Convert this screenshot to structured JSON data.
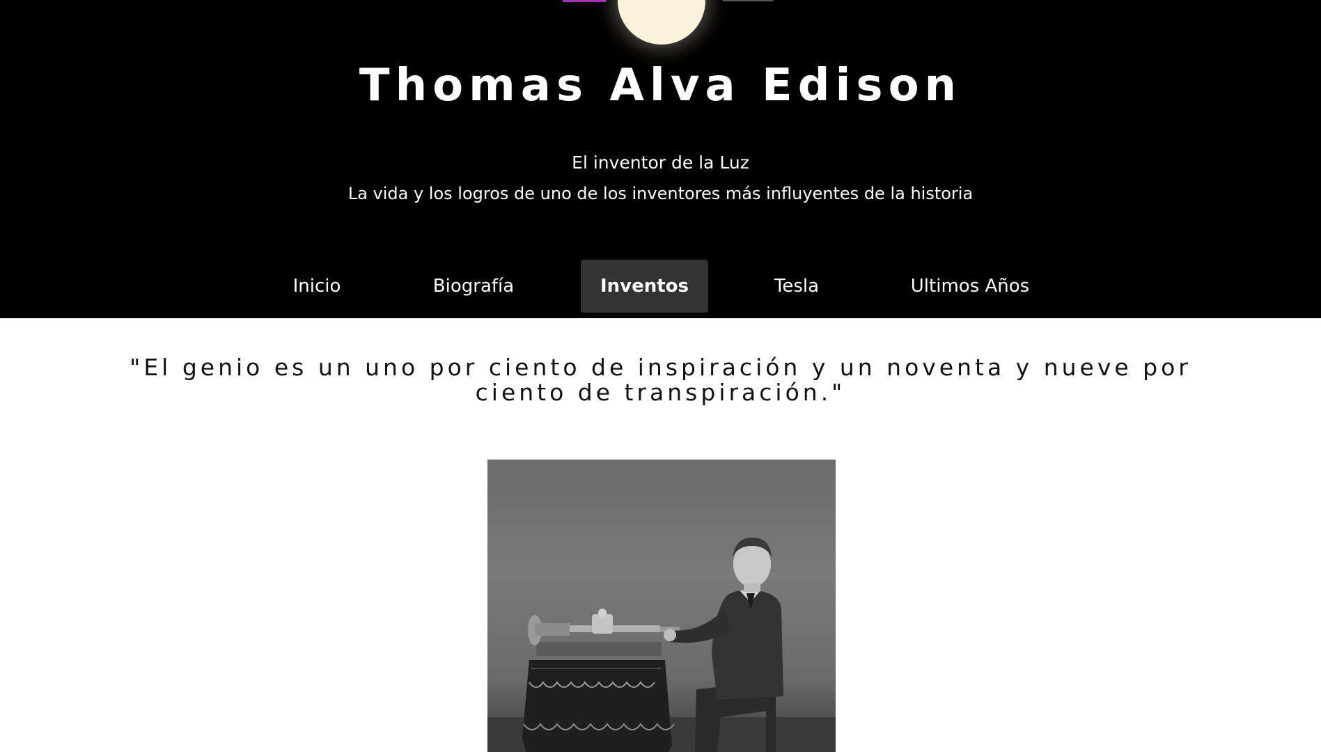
{
  "header": {
    "title": "Thomas Alva Edison",
    "tagline": "El inventor de la Luz",
    "subtitle": "La vida y los logros de uno de los inventores más influyentes de la historia"
  },
  "nav": {
    "items": [
      {
        "label": "Inicio",
        "active": false
      },
      {
        "label": "Biografía",
        "active": false
      },
      {
        "label": "Inventos",
        "active": true
      },
      {
        "label": "Tesla",
        "active": false
      },
      {
        "label": "Ultimos Años",
        "active": false
      }
    ]
  },
  "main": {
    "quote": "\"El genio es un uno por ciento de inspiración y un noventa y nueve por ciento de transpiración.\""
  },
  "colors": {
    "header_bg": "#000000",
    "bulb": "#fbf2dc",
    "nav_active_bg": "#333333",
    "page_bg": "#ffffff"
  },
  "icons": [
    "light-bulb-icon"
  ]
}
